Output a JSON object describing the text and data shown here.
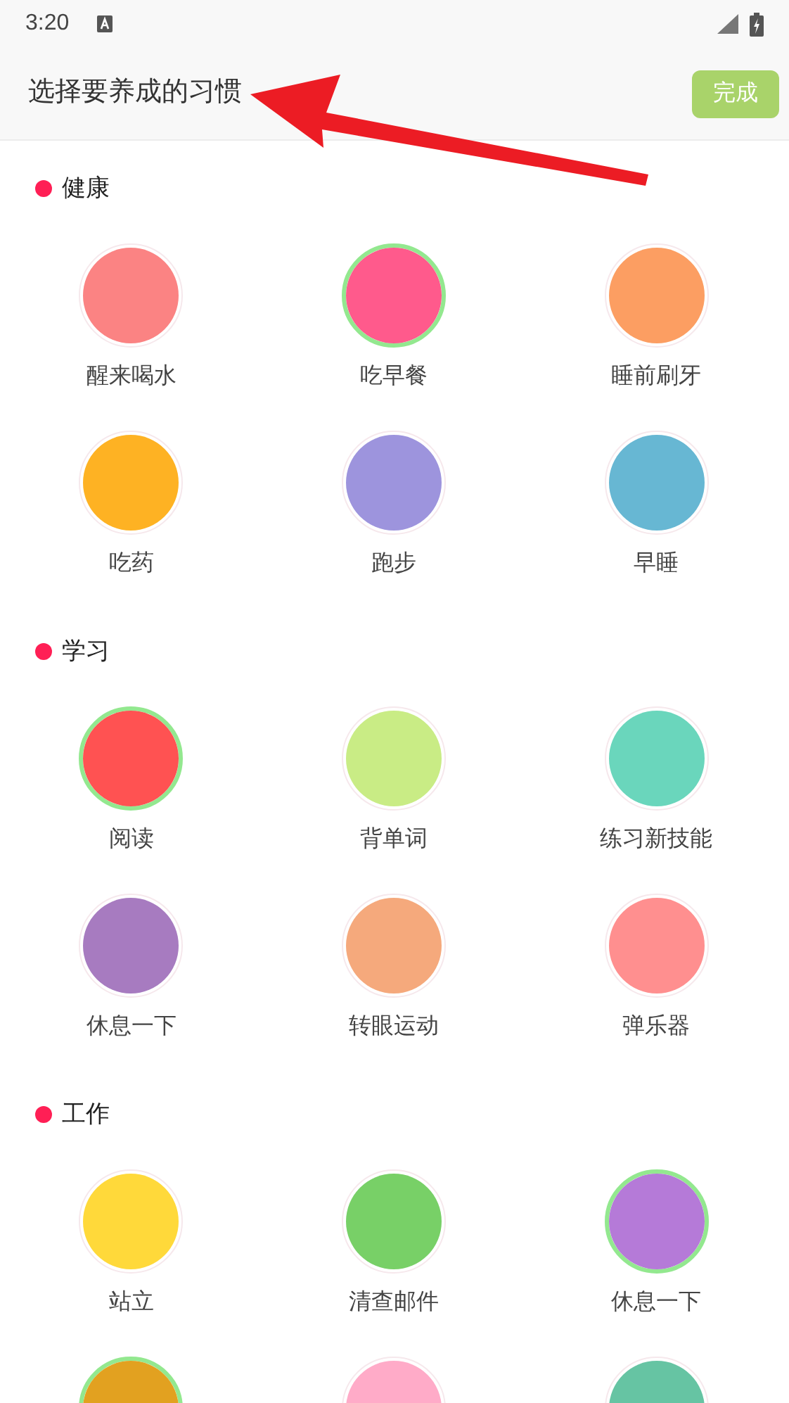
{
  "status_bar": {
    "time": "3:20"
  },
  "header": {
    "title": "选择要养成的习惯",
    "done_button": "完成"
  },
  "sections": [
    {
      "title": "健康",
      "items": [
        {
          "label": "醒来喝水",
          "color": "#fb8383",
          "selected": false
        },
        {
          "label": "吃早餐",
          "color": "#ff5a8c",
          "selected": true
        },
        {
          "label": "睡前刷牙",
          "color": "#fc9e62",
          "selected": false
        },
        {
          "label": "吃药",
          "color": "#feb223",
          "selected": false
        },
        {
          "label": "跑步",
          "color": "#9d94dd",
          "selected": false
        },
        {
          "label": "早睡",
          "color": "#67b7d3",
          "selected": false
        }
      ]
    },
    {
      "title": "学习",
      "items": [
        {
          "label": "阅读",
          "color": "#ff5252",
          "selected": true
        },
        {
          "label": "背单词",
          "color": "#c9ec85",
          "selected": false
        },
        {
          "label": "练习新技能",
          "color": "#6ad6bc",
          "selected": false
        },
        {
          "label": "休息一下",
          "color": "#a77bc0",
          "selected": false
        },
        {
          "label": "转眼运动",
          "color": "#f5a97c",
          "selected": false
        },
        {
          "label": "弹乐器",
          "color": "#ff8f8f",
          "selected": false
        }
      ]
    },
    {
      "title": "工作",
      "items": [
        {
          "label": "站立",
          "color": "#ffd93a",
          "selected": false
        },
        {
          "label": "清查邮件",
          "color": "#78d067",
          "selected": false
        },
        {
          "label": "休息一下",
          "color": "#b57ad8",
          "selected": true
        },
        {
          "color": "#e2a120",
          "selected": true
        },
        {
          "color": "#ffabc8",
          "selected": false
        },
        {
          "color": "#66c4a3",
          "selected": false
        }
      ]
    }
  ]
}
